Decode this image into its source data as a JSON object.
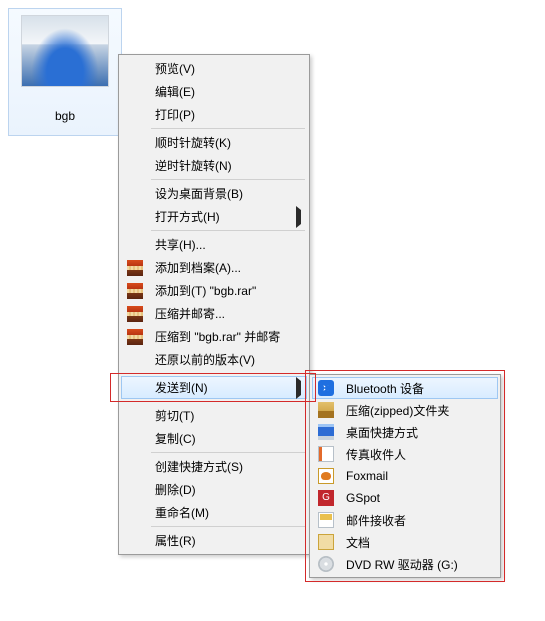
{
  "file": {
    "name": "bgb"
  },
  "menu": {
    "groups": [
      [
        {
          "id": "preview",
          "label": "预览(V)",
          "icon": null,
          "submenu": false
        },
        {
          "id": "edit",
          "label": "编辑(E)",
          "icon": null,
          "submenu": false
        },
        {
          "id": "print",
          "label": "打印(P)",
          "icon": null,
          "submenu": false
        }
      ],
      [
        {
          "id": "rotate-cw",
          "label": "顺时针旋转(K)",
          "icon": null,
          "submenu": false
        },
        {
          "id": "rotate-ccw",
          "label": "逆时针旋转(N)",
          "icon": null,
          "submenu": false
        }
      ],
      [
        {
          "id": "set-wallpaper",
          "label": "设为桌面背景(B)",
          "icon": null,
          "submenu": false
        },
        {
          "id": "open-with",
          "label": "打开方式(H)",
          "icon": null,
          "submenu": true
        }
      ],
      [
        {
          "id": "share",
          "label": "共享(H)...",
          "icon": null,
          "submenu": false
        },
        {
          "id": "add-archive",
          "label": "添加到档案(A)...",
          "icon": "rar",
          "submenu": false
        },
        {
          "id": "add-rar",
          "label": "添加到(T) \"bgb.rar\"",
          "icon": "rar",
          "submenu": false
        },
        {
          "id": "compress-mail",
          "label": "压缩并邮寄...",
          "icon": "rar",
          "submenu": false
        },
        {
          "id": "compress-rar-mail",
          "label": "压缩到 \"bgb.rar\" 并邮寄",
          "icon": "rar",
          "submenu": false
        },
        {
          "id": "restore-prev",
          "label": "还原以前的版本(V)",
          "icon": null,
          "submenu": false
        }
      ],
      [
        {
          "id": "send-to",
          "label": "发送到(N)",
          "icon": null,
          "submenu": true,
          "highlighted": true
        }
      ],
      [
        {
          "id": "cut",
          "label": "剪切(T)",
          "icon": null,
          "submenu": false
        },
        {
          "id": "copy",
          "label": "复制(C)",
          "icon": null,
          "submenu": false
        }
      ],
      [
        {
          "id": "create-shortcut",
          "label": "创建快捷方式(S)",
          "icon": null,
          "submenu": false
        },
        {
          "id": "delete",
          "label": "删除(D)",
          "icon": null,
          "submenu": false
        },
        {
          "id": "rename",
          "label": "重命名(M)",
          "icon": null,
          "submenu": false
        }
      ],
      [
        {
          "id": "properties",
          "label": "属性(R)",
          "icon": null,
          "submenu": false
        }
      ]
    ]
  },
  "submenu": {
    "items": [
      {
        "id": "bluetooth",
        "label": "Bluetooth 设备",
        "icon": "bt",
        "highlighted": true
      },
      {
        "id": "compressed-zip",
        "label": "压缩(zipped)文件夹",
        "icon": "zip"
      },
      {
        "id": "desktop-shortcut",
        "label": "桌面快捷方式",
        "icon": "desk"
      },
      {
        "id": "fax-recipient",
        "label": "传真收件人",
        "icon": "fax"
      },
      {
        "id": "foxmail",
        "label": "Foxmail",
        "icon": "fox"
      },
      {
        "id": "gspot",
        "label": "GSpot",
        "icon": "gs"
      },
      {
        "id": "mail-recipient",
        "label": "邮件接收者",
        "icon": "mail"
      },
      {
        "id": "documents",
        "label": "文档",
        "icon": "doc"
      },
      {
        "id": "dvd-rw",
        "label": "DVD RW 驱动器 (G:)",
        "icon": "dvd"
      }
    ]
  }
}
